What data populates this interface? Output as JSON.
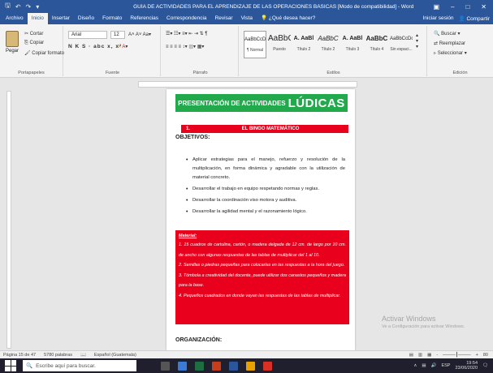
{
  "window": {
    "title": "GUÍA DE ACTIVIDADES PARA EL APRENDIZAJE DE LAS OPERACIONES BÁSICAS [Modo de compatibilidad] - Word",
    "quick_access": [
      "save-icon",
      "undo-icon",
      "redo-icon",
      "customize-icon"
    ],
    "buttons": [
      "restore-ribbon-icon",
      "minimize-icon",
      "maximize-icon",
      "close-icon"
    ]
  },
  "tabs": {
    "items": [
      "Archivo",
      "Inicio",
      "Insertar",
      "Diseño",
      "Formato",
      "Referencias",
      "Correspondencia",
      "Revisar",
      "Vista"
    ],
    "active": "Inicio",
    "tell_me": "¿Qué desea hacer?",
    "sign_in": "Iniciar sesión",
    "share": "Compartir"
  },
  "ribbon": {
    "clipboard": {
      "paste": "Pegar",
      "cut": "Cortar",
      "copy": "Copiar",
      "format_painter": "Copiar formato",
      "label": "Portapapeles"
    },
    "font": {
      "name": "Arial",
      "size": "12",
      "format_row": "N K S · abc x, x²",
      "label": "Fuente"
    },
    "paragraph": {
      "label": "Párrafo"
    },
    "styles": {
      "items": [
        {
          "preview": "AaBbCcDc",
          "name": "¶ Normal",
          "selected": true
        },
        {
          "preview": "AaBbC",
          "name": "Puesto"
        },
        {
          "preview": "A. AaBl",
          "name": "Título 2"
        },
        {
          "preview": "AaBbC",
          "name": "Título 2"
        },
        {
          "preview": "A. AaBl",
          "name": "Título 3"
        },
        {
          "preview": "AaBbC",
          "name": "Título 4"
        },
        {
          "preview": "AaBbCcDc",
          "name": "Sin espaci..."
        }
      ],
      "label": "Estilos"
    },
    "editing": {
      "find": "Buscar",
      "replace": "Reemplazar",
      "select": "Seleccionar",
      "label": "Edición"
    }
  },
  "document": {
    "banner_small": "PRESENTACIÓN DE ACTIVIDADES",
    "banner_big": "LÚDICAS",
    "section_number": "1.",
    "section_title": "EL BINGO MATEMÁTICO",
    "objectives_title": "OBJETIVOS:",
    "objectives": [
      "Aplicar estrategias para el manejo, refuerzo y resolución de la multiplicación, en forma dinámica y agradable con la utilización de material concreto.",
      "Desarrollar el trabajo en equipo respetando normas y reglas.",
      "Desarrollar la coordinación viso motora y auditiva.",
      "Desarrollar la agilidad mental y el razonamiento lógico."
    ],
    "material_title": "Material:",
    "material_items": [
      "1. 15 cuadros de cartulina, cartón, o madera delgada de 12 cm. de largo por 10 cm. de ancho con algunas respuestas de las tablas de multiplicar del 1 al 10.",
      "2. Semillas o piedras pequeñas para colocarlas en las respuestas a la hora del juego.",
      "3. Tómbola a creatividad del docente, puede utilizar dos canastos pequeños y madera para la base.",
      "4. Pequeños cuadrados en donde vayan las respuestas de las tablas de multiplicar."
    ],
    "organization_title": "ORGANIZACIÓN:"
  },
  "watermark": {
    "line1": "Activar Windows",
    "line2": "Ve a Configuración para activar Windows."
  },
  "statusbar": {
    "page": "Página 15 de 47",
    "words": "5780 palabras",
    "language": "Español (Guatemala)",
    "zoom_minus": "-",
    "zoom_plus": "+",
    "zoom_level": "80"
  },
  "taskbar": {
    "search_placeholder": "Escribe aquí para buscar.",
    "language": "ESP",
    "time": "19:54",
    "date": "23/06/2020"
  },
  "colors": {
    "word_blue": "#2b579a",
    "banner_green": "#21a94c",
    "red": "#e8001c"
  }
}
